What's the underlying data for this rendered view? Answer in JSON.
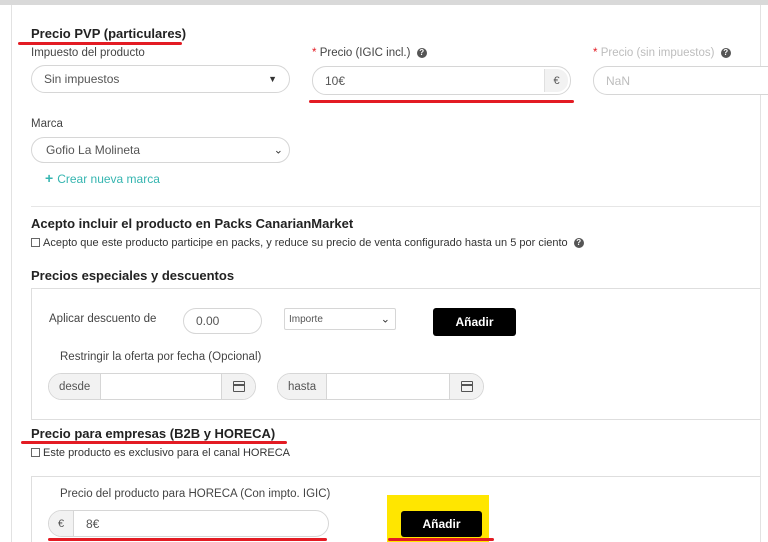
{
  "pvp": {
    "title": "Precio PVP (particulares)",
    "tax_label": "Impuesto del producto",
    "tax_value": "Sin impuestos",
    "price_label": "Precio (IGIC incl.)",
    "price_value": "10€",
    "price_addon": "€",
    "price_no_tax_label": "Precio (sin impuestos)",
    "price_no_tax_value": "NaN",
    "required_mark": "*",
    "help_glyph": "?",
    "brand_label": "Marca",
    "brand_value": "Gofio La Molineta",
    "new_brand_plus": "+",
    "new_brand_link": "Crear nueva marca"
  },
  "packs": {
    "title": "Acepto incluir el producto en Packs CanarianMarket",
    "checkbox_text": "Acepto que este producto participe en packs, y reduce su precio de venta configurado hasta un 5 por ciento"
  },
  "discounts": {
    "title": "Precios especiales y descuentos",
    "apply_label": "Aplicar descuento de",
    "amount_value": "0.00",
    "type_value": "Importe",
    "add_button": "Añadir",
    "restrict_label": "Restringir la oferta por fecha (Opcional)",
    "from_label": "desde",
    "to_label": "hasta"
  },
  "b2b": {
    "title": "Precio para empresas (B2B y HORECA)",
    "exclusive_text": "Este producto es exclusivo para el canal HORECA",
    "horeca_price_label": "Precio del producto para HORECA (Con impto. IGIC)",
    "currency_addon": "€",
    "horeca_price_value": "8€",
    "add_button": "Añadir"
  },
  "colors": {
    "accent_red": "#e31b23",
    "highlight_yellow": "#ffe600",
    "button_black": "#000000"
  },
  "icons": [
    "help-icon",
    "chevron-down-icon",
    "plus-icon",
    "calendar-icon",
    "checkbox-icon"
  ]
}
